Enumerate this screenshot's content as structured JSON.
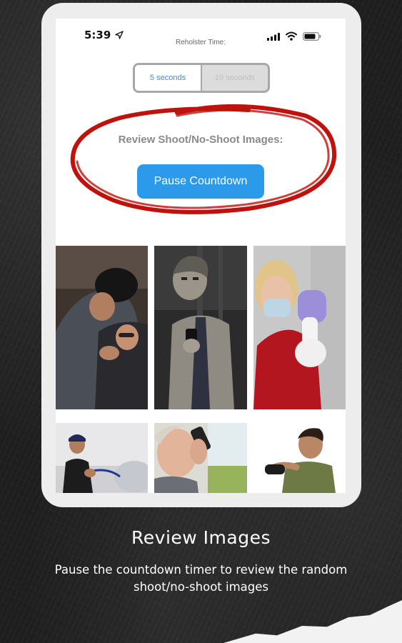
{
  "status_bar": {
    "time": "5:39",
    "label": "Reholster Time:"
  },
  "reholster_selector": {
    "options": [
      "5 seconds",
      "10 seconds"
    ],
    "selected": "5 seconds"
  },
  "review_section": {
    "label": "Review Shoot/No-Shoot Images:",
    "button_label": "Pause Countdown",
    "highlight_color": "#c0120c"
  },
  "images": [
    {
      "name": "hooded-attacker-photo"
    },
    {
      "name": "zombie-with-phone-photo"
    },
    {
      "name": "masked-woman-thermometer-photo"
    },
    {
      "name": "man-with-hose-photo"
    },
    {
      "name": "elderly-man-on-phone-photo"
    },
    {
      "name": "man-with-game-controller-photo"
    }
  ],
  "caption": {
    "title": "Review Images",
    "body": "Pause the countdown timer to review the random shoot/no-shoot images"
  },
  "colors": {
    "accent": "#2b9aea",
    "segment_active_text": "#3a8ee0",
    "background": "#1e1e1e"
  }
}
